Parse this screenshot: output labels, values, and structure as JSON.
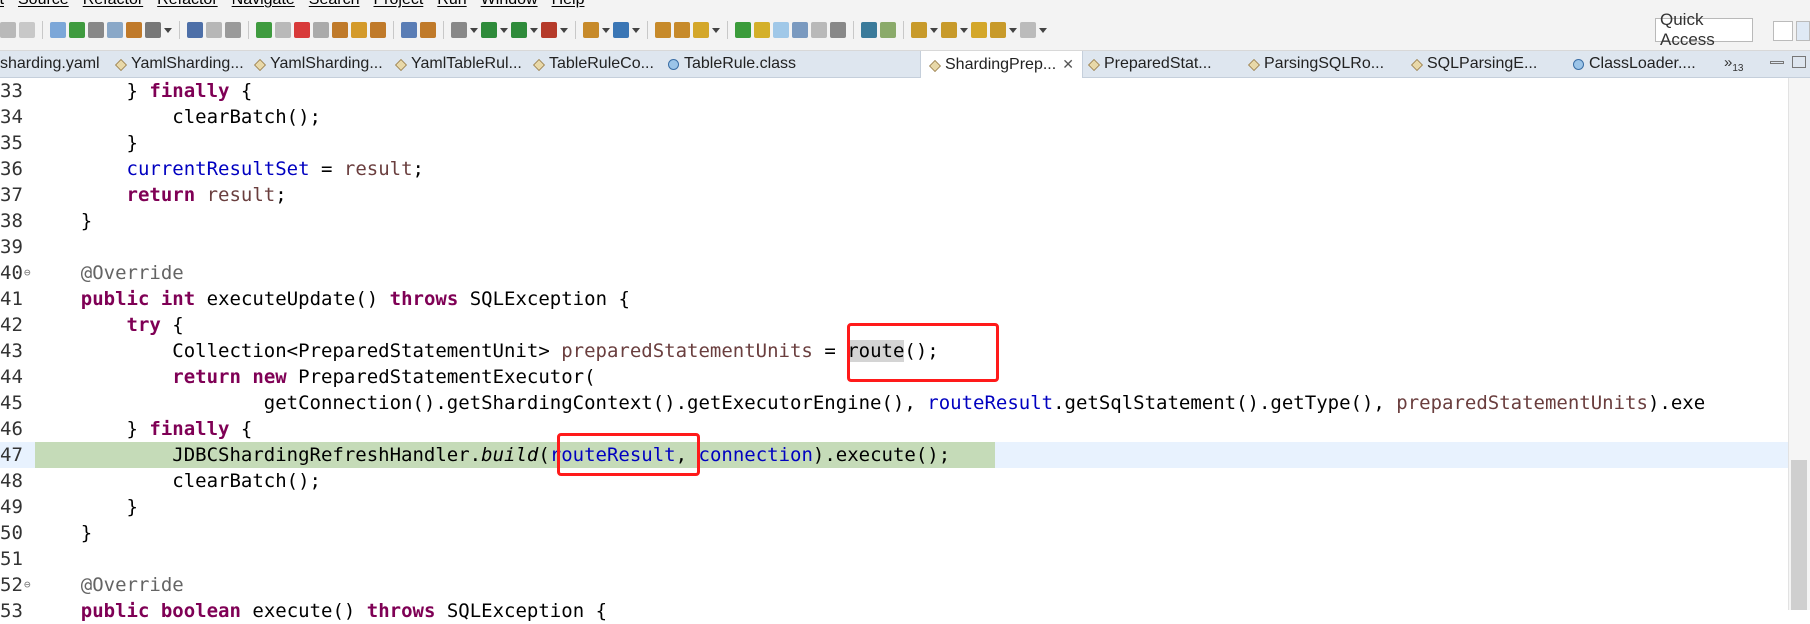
{
  "menu": {
    "items": [
      "it",
      "Source",
      "Refactor",
      "Refactor",
      "Navigate",
      "Search",
      "Project",
      "Run",
      "Window",
      "Help"
    ]
  },
  "toolbar": {
    "quick_access_label": "Quick Access"
  },
  "tabs": [
    {
      "label": "sharding.yaml",
      "icon": "yaml-file-icon",
      "active": false
    },
    {
      "label": "YamlSharding...",
      "icon": "java-class-icon",
      "active": false
    },
    {
      "label": "YamlSharding...",
      "icon": "java-class-icon",
      "active": false
    },
    {
      "label": "YamlTableRul...",
      "icon": "java-class-icon",
      "active": false
    },
    {
      "label": "TableRuleCo...",
      "icon": "java-class-icon",
      "active": false
    },
    {
      "label": "TableRule.class",
      "icon": "class-file-icon",
      "active": false
    },
    {
      "label": "ShardingPrep...",
      "icon": "java-class-icon",
      "active": true,
      "close": "✕"
    },
    {
      "label": "PreparedStat...",
      "icon": "java-class-icon",
      "active": false
    },
    {
      "label": "ParsingSQLRo...",
      "icon": "java-class-icon",
      "active": false
    },
    {
      "label": "SQLParsingE...",
      "icon": "java-class-icon",
      "active": false
    },
    {
      "label": "ClassLoader....",
      "icon": "class-file-icon",
      "active": false
    }
  ],
  "tab_overflow": {
    "label": "»",
    "count": "13"
  },
  "colors": {
    "keyword": "#7f0055",
    "field": "#0000c0",
    "local_variable": "#6a3e3e",
    "annotation": "#646464",
    "current_line": "#e8f2fe",
    "debug_line": "#c5dbb8",
    "callout_box": "#ff1a1a"
  },
  "code_lines": [
    {
      "n": "33",
      "fold": "",
      "parts": [
        [
          "",
          "        } "
        ],
        [
          "kw",
          "finally"
        ],
        [
          "",
          " {"
        ]
      ]
    },
    {
      "n": "34",
      "fold": "",
      "parts": [
        [
          "",
          "            clearBatch();"
        ]
      ]
    },
    {
      "n": "35",
      "fold": "",
      "parts": [
        [
          "",
          "        }"
        ]
      ]
    },
    {
      "n": "36",
      "fold": "",
      "parts": [
        [
          "",
          "        "
        ],
        [
          "fld",
          "currentResultSet"
        ],
        [
          "",
          " = "
        ],
        [
          "loc",
          "result"
        ],
        [
          "",
          ";"
        ]
      ]
    },
    {
      "n": "37",
      "fold": "",
      "parts": [
        [
          "",
          "        "
        ],
        [
          "kw",
          "return"
        ],
        [
          "",
          " "
        ],
        [
          "loc",
          "result"
        ],
        [
          "",
          ";"
        ]
      ]
    },
    {
      "n": "38",
      "fold": "",
      "parts": [
        [
          "",
          "    }"
        ]
      ]
    },
    {
      "n": "39",
      "fold": "",
      "parts": [
        [
          "",
          ""
        ]
      ]
    },
    {
      "n": "40",
      "fold": "⊖",
      "parts": [
        [
          "ann",
          "    @Override"
        ]
      ]
    },
    {
      "n": "41",
      "fold": "",
      "parts": [
        [
          "",
          "    "
        ],
        [
          "kw",
          "public"
        ],
        [
          "",
          " "
        ],
        [
          "kw",
          "int"
        ],
        [
          "",
          " executeUpdate() "
        ],
        [
          "kw",
          "throws"
        ],
        [
          "",
          " SQLException {"
        ]
      ]
    },
    {
      "n": "42",
      "fold": "",
      "parts": [
        [
          "",
          "        "
        ],
        [
          "kw",
          "try"
        ],
        [
          "",
          " {"
        ]
      ]
    },
    {
      "n": "43",
      "fold": "",
      "parts": [
        [
          "",
          "            Collection<PreparedStatementUnit> "
        ],
        [
          "loc",
          "preparedStatementUnits"
        ],
        [
          "",
          " = "
        ],
        [
          "occ",
          "route"
        ],
        [
          "",
          "();"
        ]
      ]
    },
    {
      "n": "44",
      "fold": "",
      "parts": [
        [
          "",
          "            "
        ],
        [
          "kw",
          "return"
        ],
        [
          "",
          " "
        ],
        [
          "kw",
          "new"
        ],
        [
          "",
          " PreparedStatementExecutor("
        ]
      ]
    },
    {
      "n": "45",
      "fold": "",
      "parts": [
        [
          "",
          "                    getConnection().getShardingContext().getExecutorEngine(), "
        ],
        [
          "fld",
          "routeResult"
        ],
        [
          "",
          ".getSqlStatement().getType(), "
        ],
        [
          "loc",
          "preparedStatementUnits"
        ],
        [
          "",
          ").exe"
        ]
      ]
    },
    {
      "n": "46",
      "fold": "",
      "parts": [
        [
          "",
          "        } "
        ],
        [
          "kw",
          "finally"
        ],
        [
          "",
          " {"
        ]
      ]
    },
    {
      "n": "47",
      "fold": "",
      "current": true,
      "parts": [
        [
          "",
          "            JDBCShardingRefreshHandler."
        ],
        [
          "it",
          "build"
        ],
        [
          "",
          "("
        ],
        [
          "fld",
          "routeResult"
        ],
        [
          "",
          ", "
        ],
        [
          "fld",
          "connection"
        ],
        [
          "",
          ").execute();"
        ]
      ]
    },
    {
      "n": "48",
      "fold": "",
      "parts": [
        [
          "",
          "            clearBatch();"
        ]
      ]
    },
    {
      "n": "49",
      "fold": "",
      "parts": [
        [
          "",
          "        }"
        ]
      ]
    },
    {
      "n": "50",
      "fold": "",
      "parts": [
        [
          "",
          "    }"
        ]
      ]
    },
    {
      "n": "51",
      "fold": "",
      "parts": [
        [
          "",
          ""
        ]
      ]
    },
    {
      "n": "52",
      "fold": "⊖",
      "parts": [
        [
          "ann",
          "    @Override"
        ]
      ]
    },
    {
      "n": "53",
      "fold": "",
      "parts": [
        [
          "",
          "    "
        ],
        [
          "kw",
          "public"
        ],
        [
          "",
          " "
        ],
        [
          "kw",
          "boolean"
        ],
        [
          "",
          " execute() "
        ],
        [
          "kw",
          "throws"
        ],
        [
          "",
          " SQLException {"
        ]
      ]
    }
  ]
}
